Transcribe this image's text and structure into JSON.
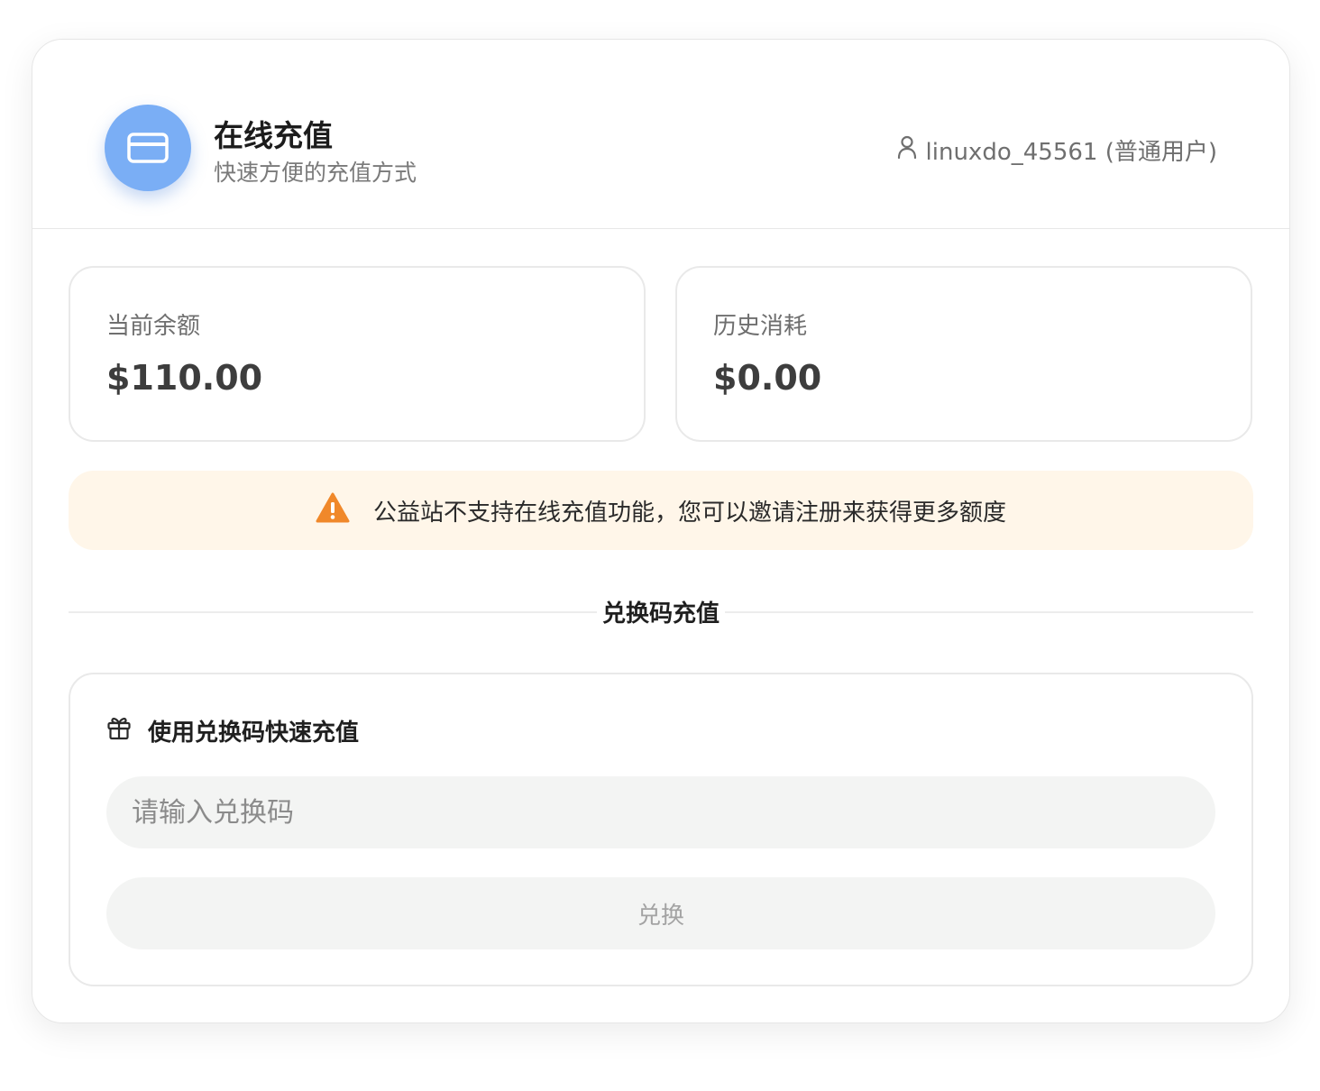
{
  "header": {
    "icon": "credit-card-icon",
    "title": "在线充值",
    "subtitle": "快速方便的充值方式",
    "user_icon": "user-icon",
    "user_text": "linuxdo_45561 (普通用户)"
  },
  "stats": {
    "balance_label": "当前余额",
    "balance_value": "$110.00",
    "consumed_label": "历史消耗",
    "consumed_value": "$0.00"
  },
  "notice": {
    "icon": "warning-icon",
    "text": "公益站不支持在线充值功能，您可以邀请注册来获得更多额度"
  },
  "section_divider": "兑换码充值",
  "redeem": {
    "icon": "gift-icon",
    "heading": "使用兑换码快速充值",
    "input_value": "",
    "input_placeholder": "请输入兑换码",
    "button_label": "兑换"
  },
  "colors": {
    "accent_icon_bg": "#7aaef5",
    "notice_bg": "#fff6e9",
    "warning": "#f0882a",
    "input_bg": "#f3f4f3"
  }
}
